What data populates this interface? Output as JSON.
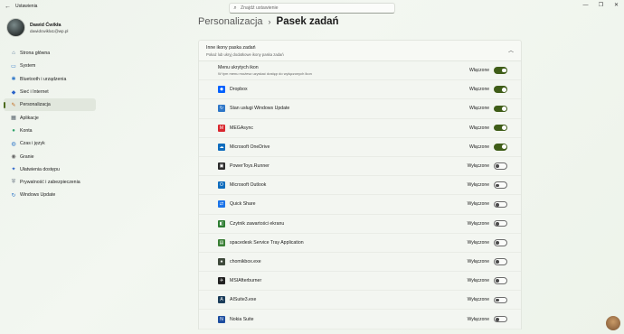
{
  "window": {
    "title": "Ustawienia"
  },
  "search": {
    "placeholder": "Znajdź ustawienie"
  },
  "profile": {
    "name": "Dawid Ćwikła",
    "email": "dawidcwikla1@wp.pl"
  },
  "sidebar": {
    "items": [
      {
        "label": "Strona główna",
        "icon": "home-icon",
        "glyph": "⌂",
        "color": "#4a6e93"
      },
      {
        "label": "System",
        "icon": "monitor-icon",
        "glyph": "▭",
        "color": "#2f77c8"
      },
      {
        "label": "Bluetooth i urządzenia",
        "icon": "bluetooth-icon",
        "glyph": "✱",
        "color": "#2f77c8"
      },
      {
        "label": "Sieć i Internet",
        "icon": "wifi-icon",
        "glyph": "◆",
        "color": "#2a62c9"
      },
      {
        "label": "Personalizacja",
        "icon": "brush-icon",
        "glyph": "✎",
        "color": "#c26a1c",
        "active": true
      },
      {
        "label": "Aplikacje",
        "icon": "apps-icon",
        "glyph": "▦",
        "color": "#55606a"
      },
      {
        "label": "Konta",
        "icon": "person-icon",
        "glyph": "●",
        "color": "#2fa36a"
      },
      {
        "label": "Czas i język",
        "icon": "globe-icon",
        "glyph": "◍",
        "color": "#2f77c8"
      },
      {
        "label": "Granie",
        "icon": "gamepad-icon",
        "glyph": "◉",
        "color": "#666"
      },
      {
        "label": "Ułatwienia dostępu",
        "icon": "accessibility-icon",
        "glyph": "✦",
        "color": "#2a62c9"
      },
      {
        "label": "Prywatność i zabezpieczenia",
        "icon": "shield-icon",
        "glyph": "⛨",
        "color": "#6b7784"
      },
      {
        "label": "Windows Update",
        "icon": "update-icon",
        "glyph": "↻",
        "color": "#2f77c8"
      }
    ]
  },
  "breadcrumb": {
    "parent": "Personalizacja",
    "separator": "›",
    "current": "Pasek zadań"
  },
  "section": {
    "title": "Inne ikony paska zadań",
    "subtitle": "Pokaż lub ukryj dodatkowe ikony paska zadań",
    "master": {
      "label": "Menu ukrytych ikon",
      "sublabel": "W tym menu możesz uzyskać dostęp do wyłączonych ikon",
      "state": "Włączone",
      "on": true
    },
    "items": [
      {
        "label": "Dropbox",
        "state": "Włączone",
        "on": true,
        "icon": "dropbox-icon",
        "color": "#0061fe",
        "glyph": "◆"
      },
      {
        "label": "Stan usługi Windows Update",
        "state": "Włączone",
        "on": true,
        "icon": "update-icon",
        "color": "#2f77c8",
        "glyph": "↻"
      },
      {
        "label": "MEGAsync",
        "state": "Włączone",
        "on": true,
        "icon": "mega-icon",
        "color": "#d9272e",
        "glyph": "M"
      },
      {
        "label": "Microsoft OneDrive",
        "state": "Włączone",
        "on": true,
        "icon": "onedrive-icon",
        "color": "#0f6cbd",
        "glyph": "☁"
      },
      {
        "label": "PowerToys.Runner",
        "state": "Wyłączone",
        "on": false,
        "icon": "powertoys-icon",
        "color": "#2b2b2b",
        "glyph": "▣"
      },
      {
        "label": "Microsoft Outlook",
        "state": "Wyłączone",
        "on": false,
        "icon": "outlook-icon",
        "color": "#0f6cbd",
        "glyph": "O"
      },
      {
        "label": "Quick Share",
        "state": "Wyłączone",
        "on": false,
        "icon": "quickshare-icon",
        "color": "#1a73e8",
        "glyph": "⇄"
      },
      {
        "label": "Czytnik zawartości ekranu",
        "state": "Wyłączone",
        "on": false,
        "icon": "reader-icon",
        "color": "#2e7d32",
        "glyph": "◧"
      },
      {
        "label": "spacedesk Service Tray Application",
        "state": "Wyłączone",
        "on": false,
        "icon": "spacedesk-icon",
        "color": "#3a7f35",
        "glyph": "▤"
      },
      {
        "label": "chomikbox.exe",
        "state": "Wyłączone",
        "on": false,
        "icon": "chomikbox-icon",
        "color": "#3f4a3c",
        "glyph": "●"
      },
      {
        "label": "MSIAfterburner",
        "state": "Wyłączone",
        "on": false,
        "icon": "afterburner-icon",
        "color": "#222",
        "glyph": "✈"
      },
      {
        "label": "AISuite3.exe",
        "state": "Wyłączone",
        "on": false,
        "icon": "aisuite-icon",
        "color": "#1c3d5a",
        "glyph": "A"
      },
      {
        "label": "Nokia Suite",
        "state": "Wyłączone",
        "on": false,
        "icon": "nokia-icon",
        "color": "#1d4ea0",
        "glyph": "N"
      }
    ]
  }
}
